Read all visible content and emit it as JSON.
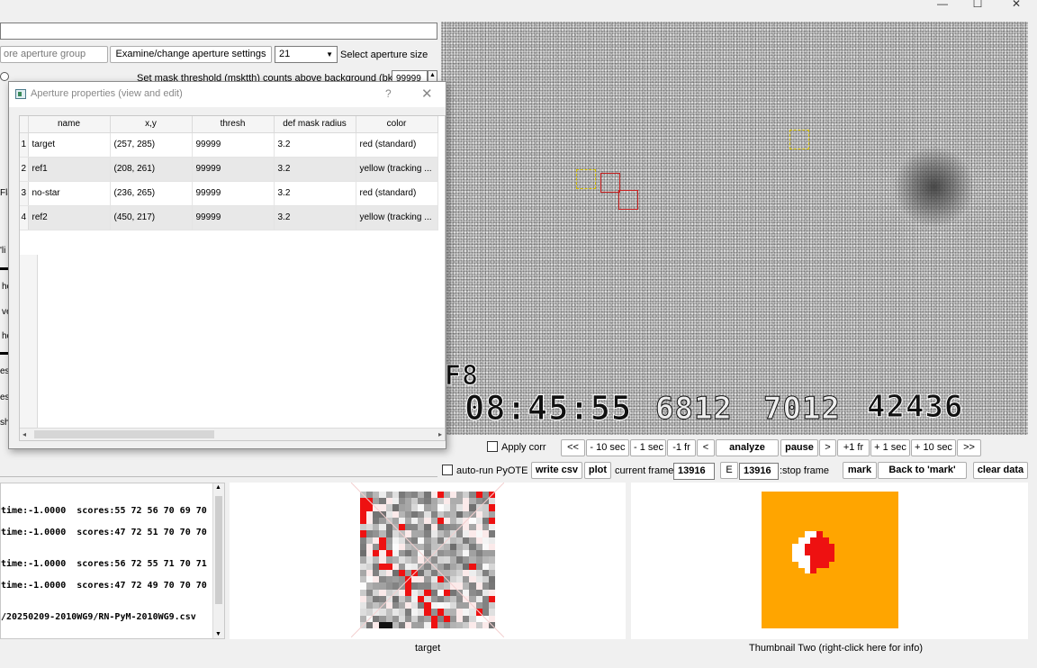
{
  "window": {
    "minimize": "—",
    "maximize": "☐",
    "close": "✕"
  },
  "main": {
    "aperture_group_button": "ore aperture group",
    "examine_button": "Examine/change aperture settings",
    "aperture_size_value": "21",
    "aperture_size_label": "Select aperture size",
    "mask_threshold_label": "Set mask threshold (msktth) counts above background (bkavg)",
    "mask_threshold_value": "99999",
    "left_fragments": [
      "Fla",
      "'li",
      "hc",
      "ve",
      "hc",
      "es",
      "est",
      "sho"
    ]
  },
  "dialog": {
    "title": "Aperture properties (view and edit)",
    "help": "?",
    "close": "✕",
    "columns": [
      "name",
      "x,y",
      "thresh",
      "def mask radius",
      "color"
    ],
    "rows": [
      {
        "num": "1",
        "name": "target",
        "xy": "(257, 285)",
        "thresh": "99999",
        "radius": "3.2",
        "color": "red (standard)"
      },
      {
        "num": "2",
        "name": "ref1",
        "xy": "(208, 261)",
        "thresh": "99999",
        "radius": "3.2",
        "color": "yellow (tracking ..."
      },
      {
        "num": "3",
        "name": "no-star",
        "xy": "(236, 265)",
        "thresh": "99999",
        "radius": "3.2",
        "color": "red (standard)"
      },
      {
        "num": "4",
        "name": "ref2",
        "xy": "(450, 217)",
        "thresh": "99999",
        "radius": "3.2",
        "color": "yellow (tracking ..."
      }
    ],
    "scroll_left": "◂",
    "scroll_right": "▸"
  },
  "video": {
    "field_label": "F8",
    "timestamp": "08:45:55",
    "counter1": "6812",
    "counter2": "7012",
    "counter3": "42436",
    "colors": {
      "yellow_aperture": "#d9c200",
      "red_aperture": "#c82020"
    }
  },
  "controls": {
    "apply_corr": "Apply corr",
    "btn_back_start": "<<",
    "btn_minus10": "- 10 sec",
    "btn_minus1sec": "- 1 sec",
    "btn_minus1fr": "-1 fr",
    "btn_back": "<",
    "btn_analyze": "analyze",
    "btn_pause": "pause",
    "btn_fwd": ">",
    "btn_plus1fr": "+1 fr",
    "btn_plus1sec": "+ 1 sec",
    "btn_plus10": "+ 10 sec",
    "btn_end": ">>",
    "auto_run": "auto-run PyOTE",
    "write_csv": "write csv",
    "plot": "plot",
    "current_frame_label": "current frame:",
    "current_frame_value": "13916",
    "e_label": "E",
    "stop_frame_value": "13916",
    "stop_frame_label": ":stop frame",
    "mark": "mark",
    "back_to_mark": "Back to 'mark'",
    "clear_data": "clear data"
  },
  "log": {
    "lines": [
      "time:-1.0000  scores:55 72 56 70 69 70",
      "time:-1.0000  scores:47 72 51 70 70 70",
      "time:-1.0000  scores:56 72 55 71 70 71",
      "time:-1.0000  scores:47 72 49 70 70 70",
      "/20250209-2010WG9/RN-PyM-2010WG9.csv"
    ]
  },
  "thumbnails": {
    "one_caption": "target",
    "two_caption": "Thumbnail Two (right-click here for info)",
    "colors": {
      "orange": "#ffa500",
      "red": "#ee1111"
    }
  }
}
